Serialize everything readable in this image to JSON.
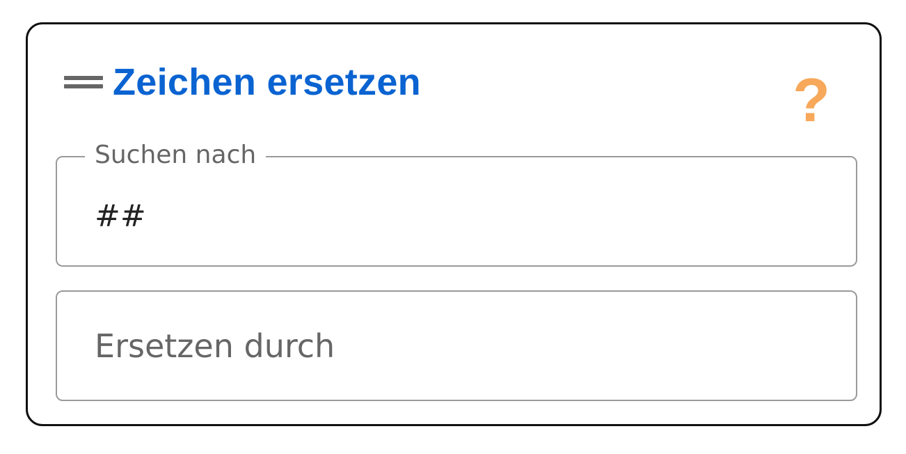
{
  "panel": {
    "title": "Zeichen ersetzen",
    "title_color": "#0a63d1",
    "drag_icon": "drag-handle-icon",
    "help_icon": "question-mark-icon",
    "help_glyph": "?",
    "help_color": "#f7a85a"
  },
  "search_field": {
    "label": "Suchen nach",
    "value": "##"
  },
  "replace_field": {
    "placeholder": "Ersetzen durch",
    "value": ""
  }
}
